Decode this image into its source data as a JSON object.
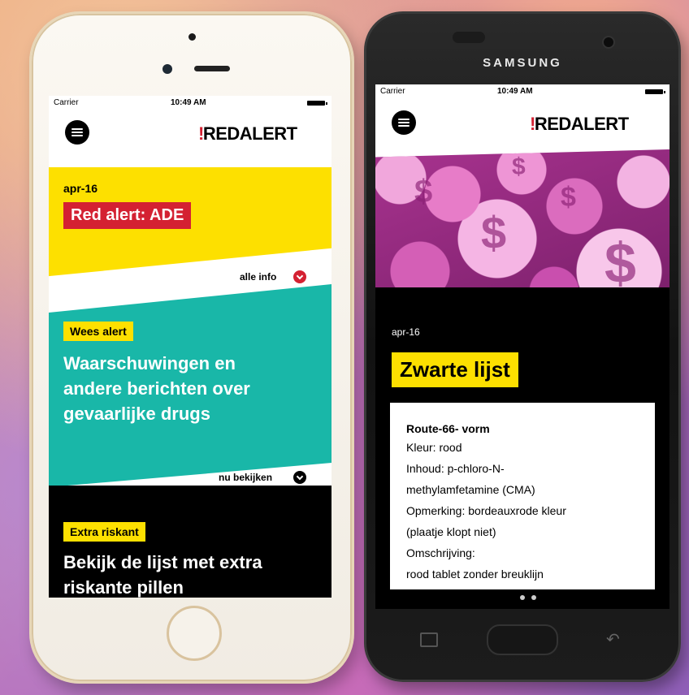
{
  "iphone": {
    "status": {
      "carrier": "Carrier",
      "time": "10:49 AM"
    },
    "logo": {
      "bang": "!",
      "text": "REDALERT"
    },
    "section1": {
      "date": "apr-16",
      "title": "Red alert: ADE",
      "link": "alle info"
    },
    "section2": {
      "tag": "Wees alert",
      "heading": [
        "Waarschuwingen en",
        "andere berichten over",
        "gevaarlijke drugs"
      ],
      "link": "nu bekijken"
    },
    "section3": {
      "tag": "Extra riskant",
      "heading": [
        "Bekijk de lijst met extra",
        "riskante pillen"
      ]
    }
  },
  "samsung": {
    "brand": "SAMSUNG",
    "status": {
      "carrier": "Carrier",
      "time": "10:49 AM"
    },
    "logo": {
      "bang": "!",
      "text": "REDALERT"
    },
    "date": "apr-16",
    "title": "Zwarte lijst",
    "card": {
      "title": "Route-66- vorm",
      "lines": [
        "Kleur: rood",
        "Inhoud: p-chloro-N-",
        "methylamfetamine (CMA)",
        "Opmerking: bordeauxrode kleur",
        "(plaatje klopt niet)",
        "Omschrijving:",
        "rood tablet zonder breuklijn"
      ]
    },
    "pagination": {
      "total": 3,
      "active": 1
    }
  },
  "colors": {
    "red": "#d42132",
    "yellow": "#fde000",
    "teal": "#19b7a8",
    "black": "#000000"
  }
}
